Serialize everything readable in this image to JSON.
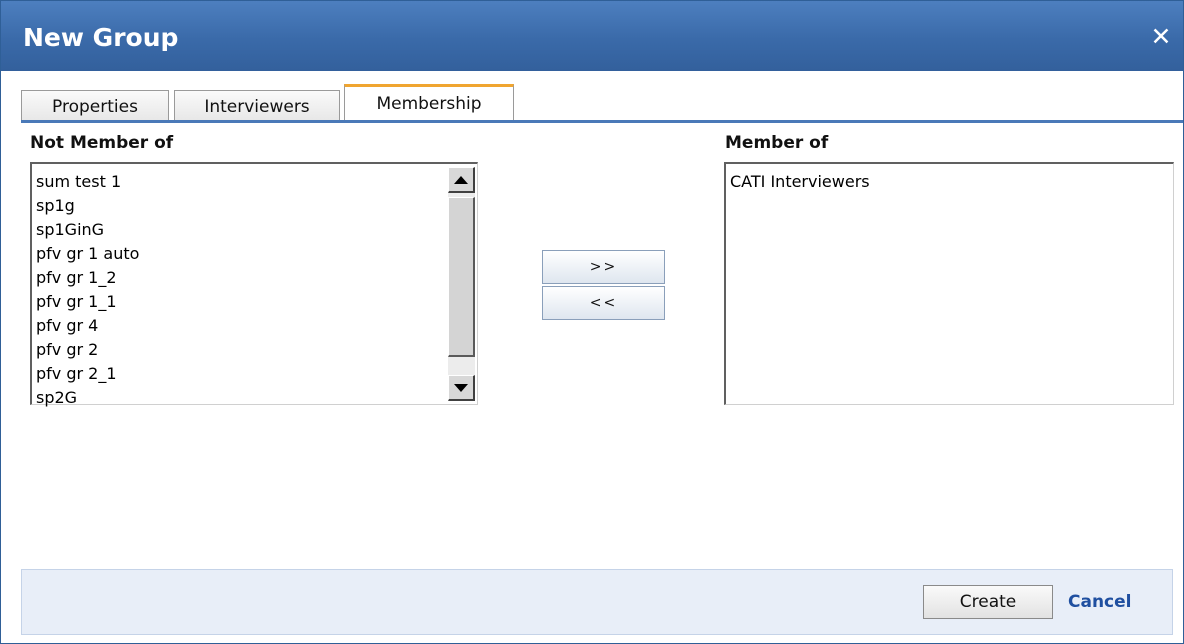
{
  "dialog": {
    "title": "New Group",
    "close_glyph": "✕",
    "close_icon": "close-icon"
  },
  "tabs": [
    {
      "label": "Properties",
      "active": false
    },
    {
      "label": "Interviewers",
      "active": false
    },
    {
      "label": "Membership",
      "active": true
    }
  ],
  "membership": {
    "not_member_label": "Not Member of",
    "member_label": "Member of",
    "not_member_items": [
      "sum test 1",
      "sp1g",
      "sp1GinG",
      "pfv gr 1 auto",
      "pfv gr 1_2",
      "pfv gr 1_1",
      "pfv gr 4",
      "pfv gr 2",
      "pfv gr 2_1",
      "sp2G"
    ],
    "member_items": [
      "CATI Interviewers"
    ],
    "add_label": ">>",
    "remove_label": "<<"
  },
  "footer": {
    "create_label": "Create",
    "cancel_label": "Cancel"
  },
  "colors": {
    "titlebar": "#3a6aa9",
    "tab_accent": "#f0a530",
    "footer_bg": "#e8eef8",
    "link": "#1f4fa0"
  }
}
